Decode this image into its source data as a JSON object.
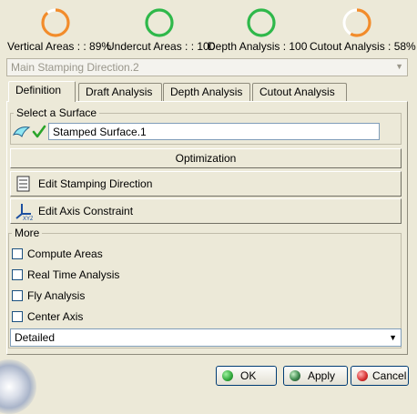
{
  "gauges": [
    {
      "name": "vertical-areas",
      "label": "Vertical Areas :",
      "value_text": ": 89%",
      "value": 89,
      "color": "#f28c2b"
    },
    {
      "name": "undercut-areas",
      "label": "Undercut Areas :",
      "value_text": ": 100%",
      "value": 100,
      "color": "#2fb84a"
    },
    {
      "name": "depth-analysis",
      "label": "Depth Analysis :",
      "value_text": ": 100%",
      "value": 100,
      "color": "#2fb84a"
    },
    {
      "name": "cutout-analysis",
      "label": "Cutout Analysis :",
      "value_text": ": 58%",
      "value": 58,
      "color": "#f28c2b"
    }
  ],
  "labels_text": {
    "vertical": "Vertical Areas : : 89%",
    "undercut": "Undercut Areas : : 100",
    "depth": "Depth Analysis : 100",
    "cutout": "Cutout Analysis : 58%"
  },
  "direction_combo": {
    "value": "Main Stamping Direction.2"
  },
  "tabs": [
    {
      "label": "Definition"
    },
    {
      "label": "Draft Analysis"
    },
    {
      "label": "Depth Analysis"
    },
    {
      "label": "Cutout Analysis"
    }
  ],
  "select_surface": {
    "legend": "Select a Surface",
    "value": "Stamped Surface.1"
  },
  "buttons": {
    "optimization": "Optimization",
    "edit_stamping": "Edit Stamping Direction",
    "edit_axis": "Edit Axis Constraint"
  },
  "more": {
    "legend": "More",
    "options": [
      {
        "label": "Compute Areas"
      },
      {
        "label": "Real Time Analysis"
      },
      {
        "label": "Fly Analysis"
      },
      {
        "label": "Center Axis"
      }
    ],
    "mode": "Detailed"
  },
  "dialog": {
    "ok": "OK",
    "apply": "Apply",
    "cancel": "Cancel"
  },
  "colors": {
    "ok": "#2fa63a",
    "apply": "#4b5563",
    "cancel": "#d62e2e",
    "check": "#2aa52a"
  }
}
